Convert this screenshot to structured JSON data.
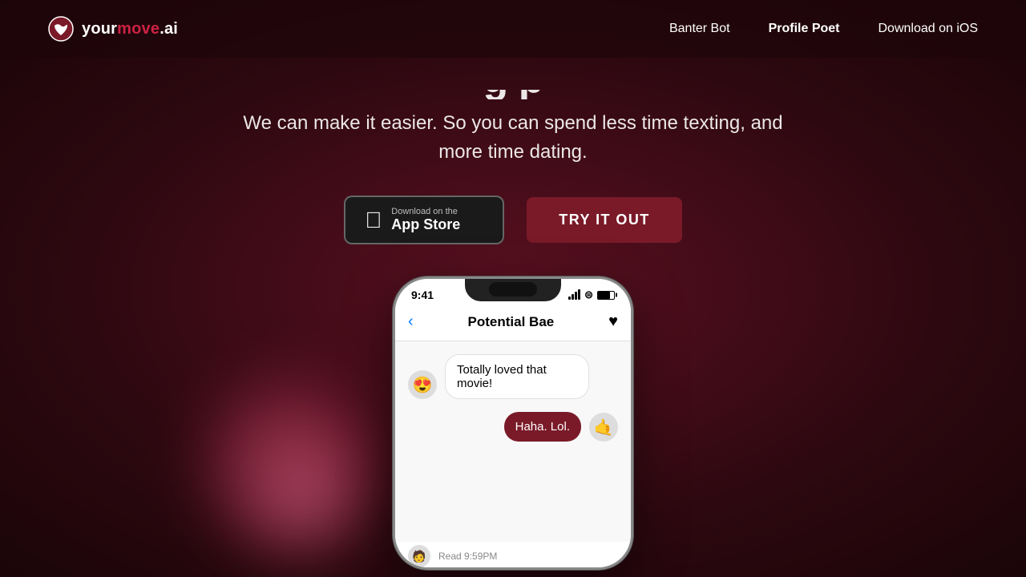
{
  "brand": {
    "name_your": "your",
    "name_move": "move",
    "name_ai": ".ai",
    "full": "yourmove.ai"
  },
  "nav": {
    "links": [
      {
        "id": "banter-bot",
        "label": "Banter Bot",
        "active": false
      },
      {
        "id": "profile-poet",
        "label": "Profile Poet",
        "active": true
      },
      {
        "id": "download-ios",
        "label": "Download on iOS",
        "active": false
      }
    ]
  },
  "hero": {
    "title_partial": "g p...",
    "subtitle": "We can make it easier. So you can spend less time texting, and more time dating.",
    "app_store_line1": "Download on the",
    "app_store_line2": "App Store",
    "try_button": "TRY IT OUT"
  },
  "phone": {
    "time": "9:41",
    "chat_title": "Potential Bae",
    "messages": [
      {
        "type": "incoming",
        "text": "Totally loved that movie!",
        "avatar": "😍"
      },
      {
        "type": "outgoing",
        "text": "Haha. Lol.",
        "avatar": "🤙"
      },
      {
        "type": "read",
        "text": "Read 9:59PM",
        "avatar": "🧑"
      }
    ]
  }
}
